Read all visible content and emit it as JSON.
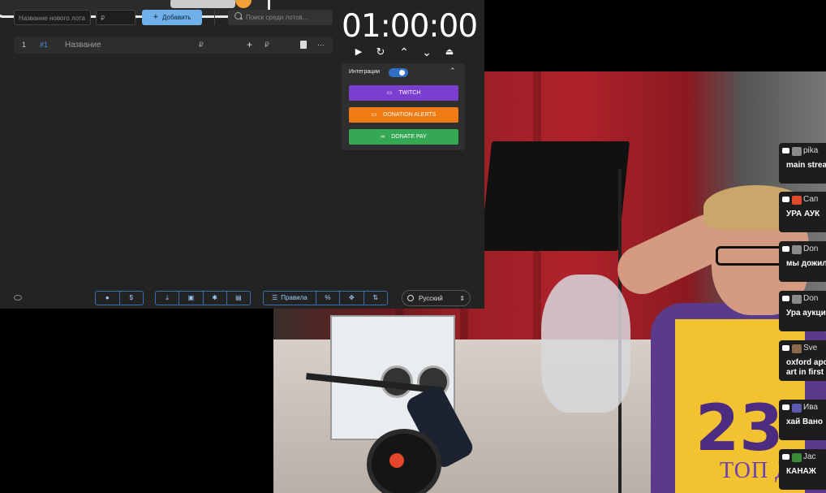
{
  "new_lot": {
    "name_placeholder": "Название нового лота",
    "price_placeholder": "₽",
    "add_label": "Добавить"
  },
  "search": {
    "placeholder": "Поиск среди лотов..."
  },
  "lot": {
    "index": "1",
    "id": "#1",
    "name_placeholder": "Название",
    "amount_placeholder": "₽",
    "plus": "+",
    "extra_placeholder": "₽",
    "more": "···"
  },
  "timer": {
    "value": "01:00:00",
    "play": "▶",
    "reset": "↻",
    "up": "⌃",
    "down": "⌄",
    "collapse": "⏏"
  },
  "integrations": {
    "title": "Интеграции",
    "toggle_on": true,
    "twitch": "TWITCH",
    "donation_alerts": "DONATION ALERTS",
    "donate_pay": "DONATE PAY",
    "colors": {
      "twitch": "#7b3fd0",
      "donation_alerts": "#f07b12",
      "donate_pay": "#34a853"
    }
  },
  "toolbar": {
    "rules": "Правила",
    "percent": "%",
    "language": "Русский"
  },
  "chat": [
    {
      "name": "pika",
      "message": "main strea",
      "avatar_color": "#8a8a8a"
    },
    {
      "name": "Сап",
      "message": "УРА АУК",
      "avatar_color": "#e04a2a"
    },
    {
      "name": "Don",
      "message": "мы дожил",
      "avatar_color": "#8a8a8a"
    },
    {
      "name": "Don",
      "message": "Ура аукци",
      "avatar_color": "#8a8a8a"
    },
    {
      "name": "Sve",
      "message": "oxford apo\nart in first",
      "avatar_color": "#8a6a4a"
    },
    {
      "name": "Ива",
      "message": "хай Вано",
      "avatar_color": "#5a5ab0"
    },
    {
      "name": "Jac",
      "message": "КАНАЖ",
      "avatar_color": "#3a8a3a"
    }
  ],
  "stream_overlay": {
    "text": "ТОП ДНЯ"
  }
}
